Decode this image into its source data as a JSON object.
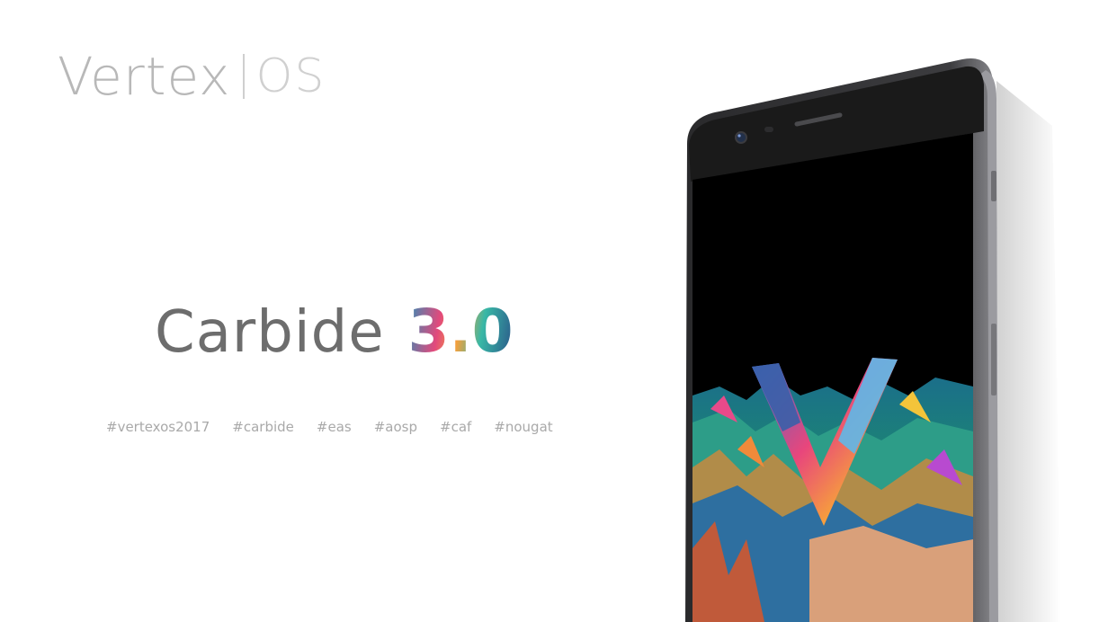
{
  "logo": {
    "wordmark": "Vertex",
    "suffix": "OS"
  },
  "headline": {
    "name": "Carbide",
    "version": "3.0"
  },
  "tags": [
    "#vertexos2017",
    "#carbide",
    "#eas",
    "#aosp",
    "#caf",
    "#nougat"
  ],
  "phone": {
    "screen_graphic": "v-logo-colorful-landscape-icon"
  },
  "colors": {
    "background": "#ffffff",
    "logo_text": "#b8b8b8",
    "headline_text": "#6d6d6d",
    "tag_text": "#a9a9a9",
    "phone_body": "#3a3a3c",
    "phone_screen": "#000000"
  }
}
